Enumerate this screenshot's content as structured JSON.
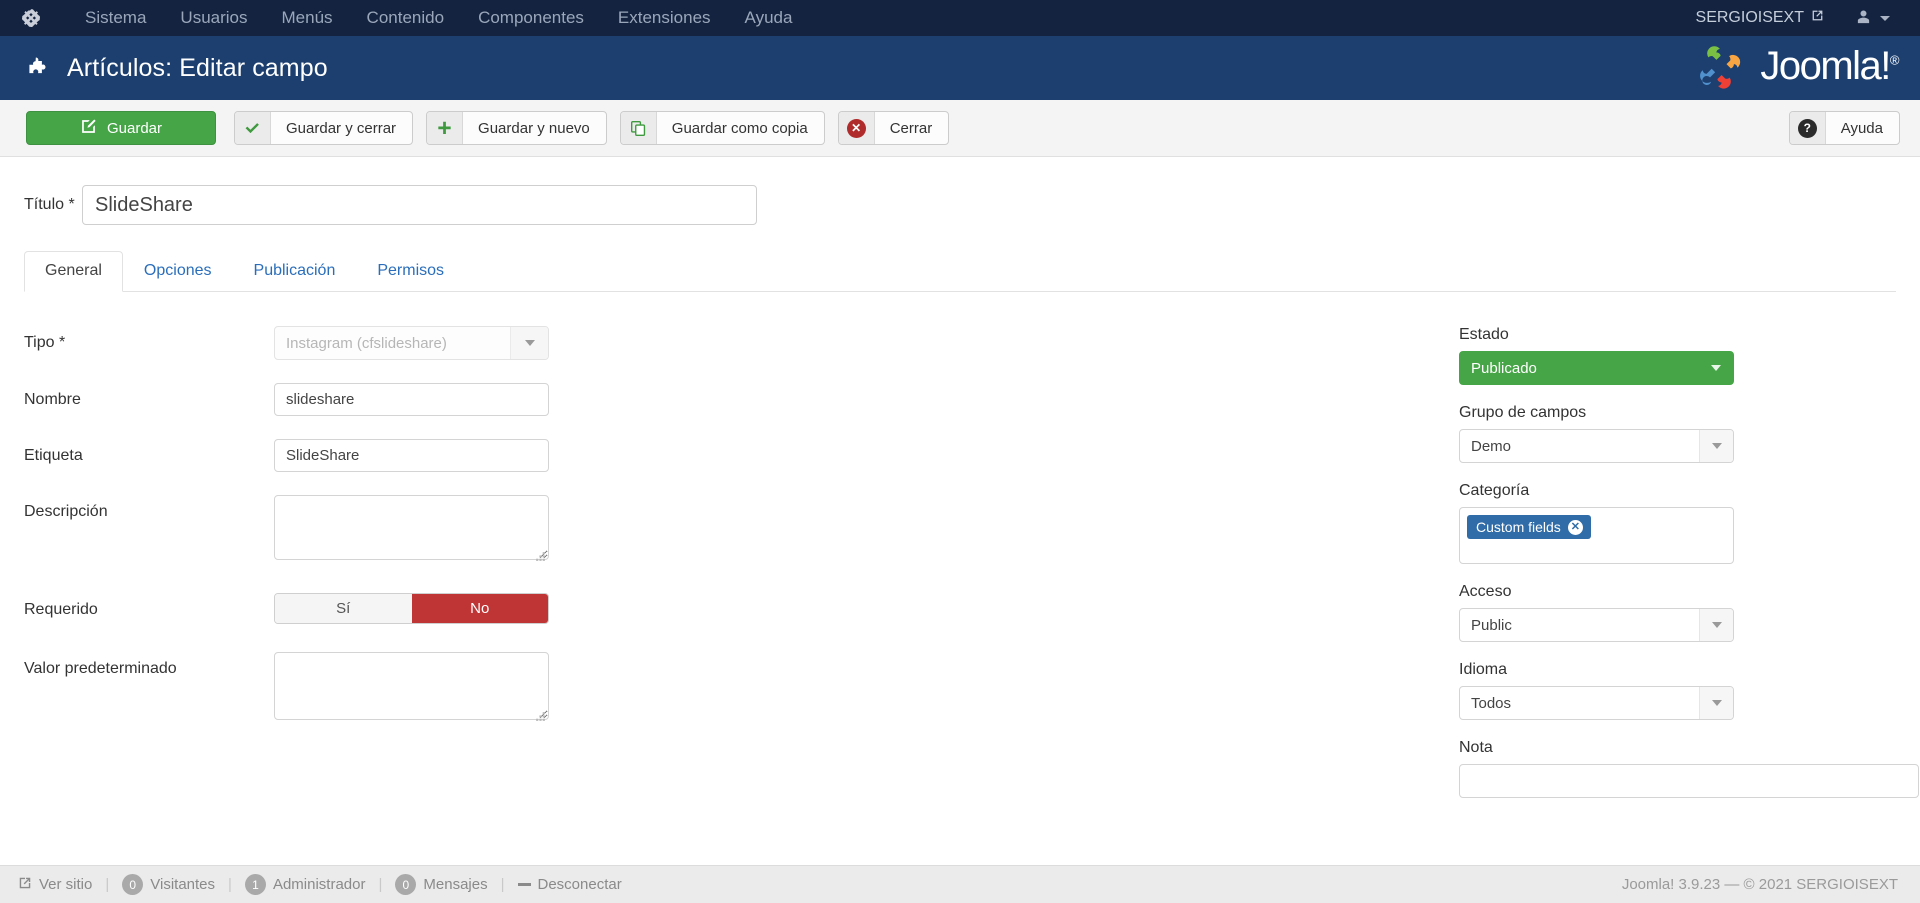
{
  "topnav": {
    "logo_icon": "joomla-logo-icon",
    "items": [
      {
        "label": "Sistema"
      },
      {
        "label": "Usuarios"
      },
      {
        "label": "Menús"
      },
      {
        "label": "Contenido"
      },
      {
        "label": "Componentes"
      },
      {
        "label": "Extensiones"
      },
      {
        "label": "Ayuda"
      }
    ],
    "site_name": "SERGIOISEXT",
    "site_icon": "external-link-icon",
    "user_icon": "user-icon",
    "user_caret_icon": "chevron-down-icon"
  },
  "header": {
    "icon": "puzzle-piece-icon",
    "title": "Artículos: Editar campo",
    "brand": "Joomla!",
    "brand_reg": "®"
  },
  "toolbar": {
    "save": {
      "label": "Guardar",
      "icon": "pencil-square-icon"
    },
    "save_close": {
      "label": "Guardar y cerrar",
      "icon": "check-icon"
    },
    "save_new": {
      "label": "Guardar y nuevo",
      "icon": "plus-icon"
    },
    "save_copy": {
      "label": "Guardar como copia",
      "icon": "copy-icon"
    },
    "close": {
      "label": "Cerrar",
      "icon": "close-circle-icon"
    },
    "help": {
      "label": "Ayuda",
      "icon": "question-circle-icon"
    }
  },
  "form": {
    "title_label": "Título *",
    "title_value": "SlideShare",
    "title_placeholder": "",
    "tabs": [
      {
        "label": "General",
        "active": true
      },
      {
        "label": "Opciones",
        "active": false
      },
      {
        "label": "Publicación",
        "active": false
      },
      {
        "label": "Permisos",
        "active": false
      }
    ],
    "fields": {
      "tipo": {
        "label": "Tipo *",
        "value": "Instagram (cfslideshare)",
        "arrow_icon": "chevron-down-icon"
      },
      "nombre": {
        "label": "Nombre",
        "value": "slideshare"
      },
      "etiqueta": {
        "label": "Etiqueta",
        "value": "SlideShare"
      },
      "descripcion": {
        "label": "Descripción",
        "value": ""
      },
      "requerido": {
        "label": "Requerido",
        "yes_label": "Sí",
        "no_label": "No",
        "selected": "No"
      },
      "valor_predeterminado": {
        "label": "Valor predeterminado",
        "value": ""
      }
    }
  },
  "sidebar": {
    "estado": {
      "label": "Estado",
      "value": "Publicado",
      "color": "#46a546",
      "arrow_icon": "chevron-down-icon"
    },
    "grupo_campos": {
      "label": "Grupo de campos",
      "value": "Demo",
      "arrow_icon": "chevron-down-icon"
    },
    "categoria": {
      "label": "Categoría",
      "chips": [
        {
          "label": "Custom fields",
          "remove_icon": "close-circle-icon"
        }
      ],
      "chip_color": "#2f6ca8"
    },
    "acceso": {
      "label": "Acceso",
      "value": "Public",
      "arrow_icon": "chevron-down-icon"
    },
    "idioma": {
      "label": "Idioma",
      "value": "Todos",
      "arrow_icon": "chevron-down-icon"
    },
    "nota": {
      "label": "Nota",
      "value": ""
    }
  },
  "footer": {
    "view_site": {
      "label": "Ver sitio",
      "icon": "external-link-icon"
    },
    "visitors": {
      "count": "0",
      "label": "Visitantes"
    },
    "admins": {
      "count": "1",
      "label": "Administrador"
    },
    "messages": {
      "count": "0",
      "label": "Mensajes"
    },
    "logout": {
      "label": "Desconectar",
      "icon": "minus-icon"
    },
    "separator": "|",
    "copyright": "Joomla! 3.9.23  —  © 2021 SERGIOISEXT"
  }
}
